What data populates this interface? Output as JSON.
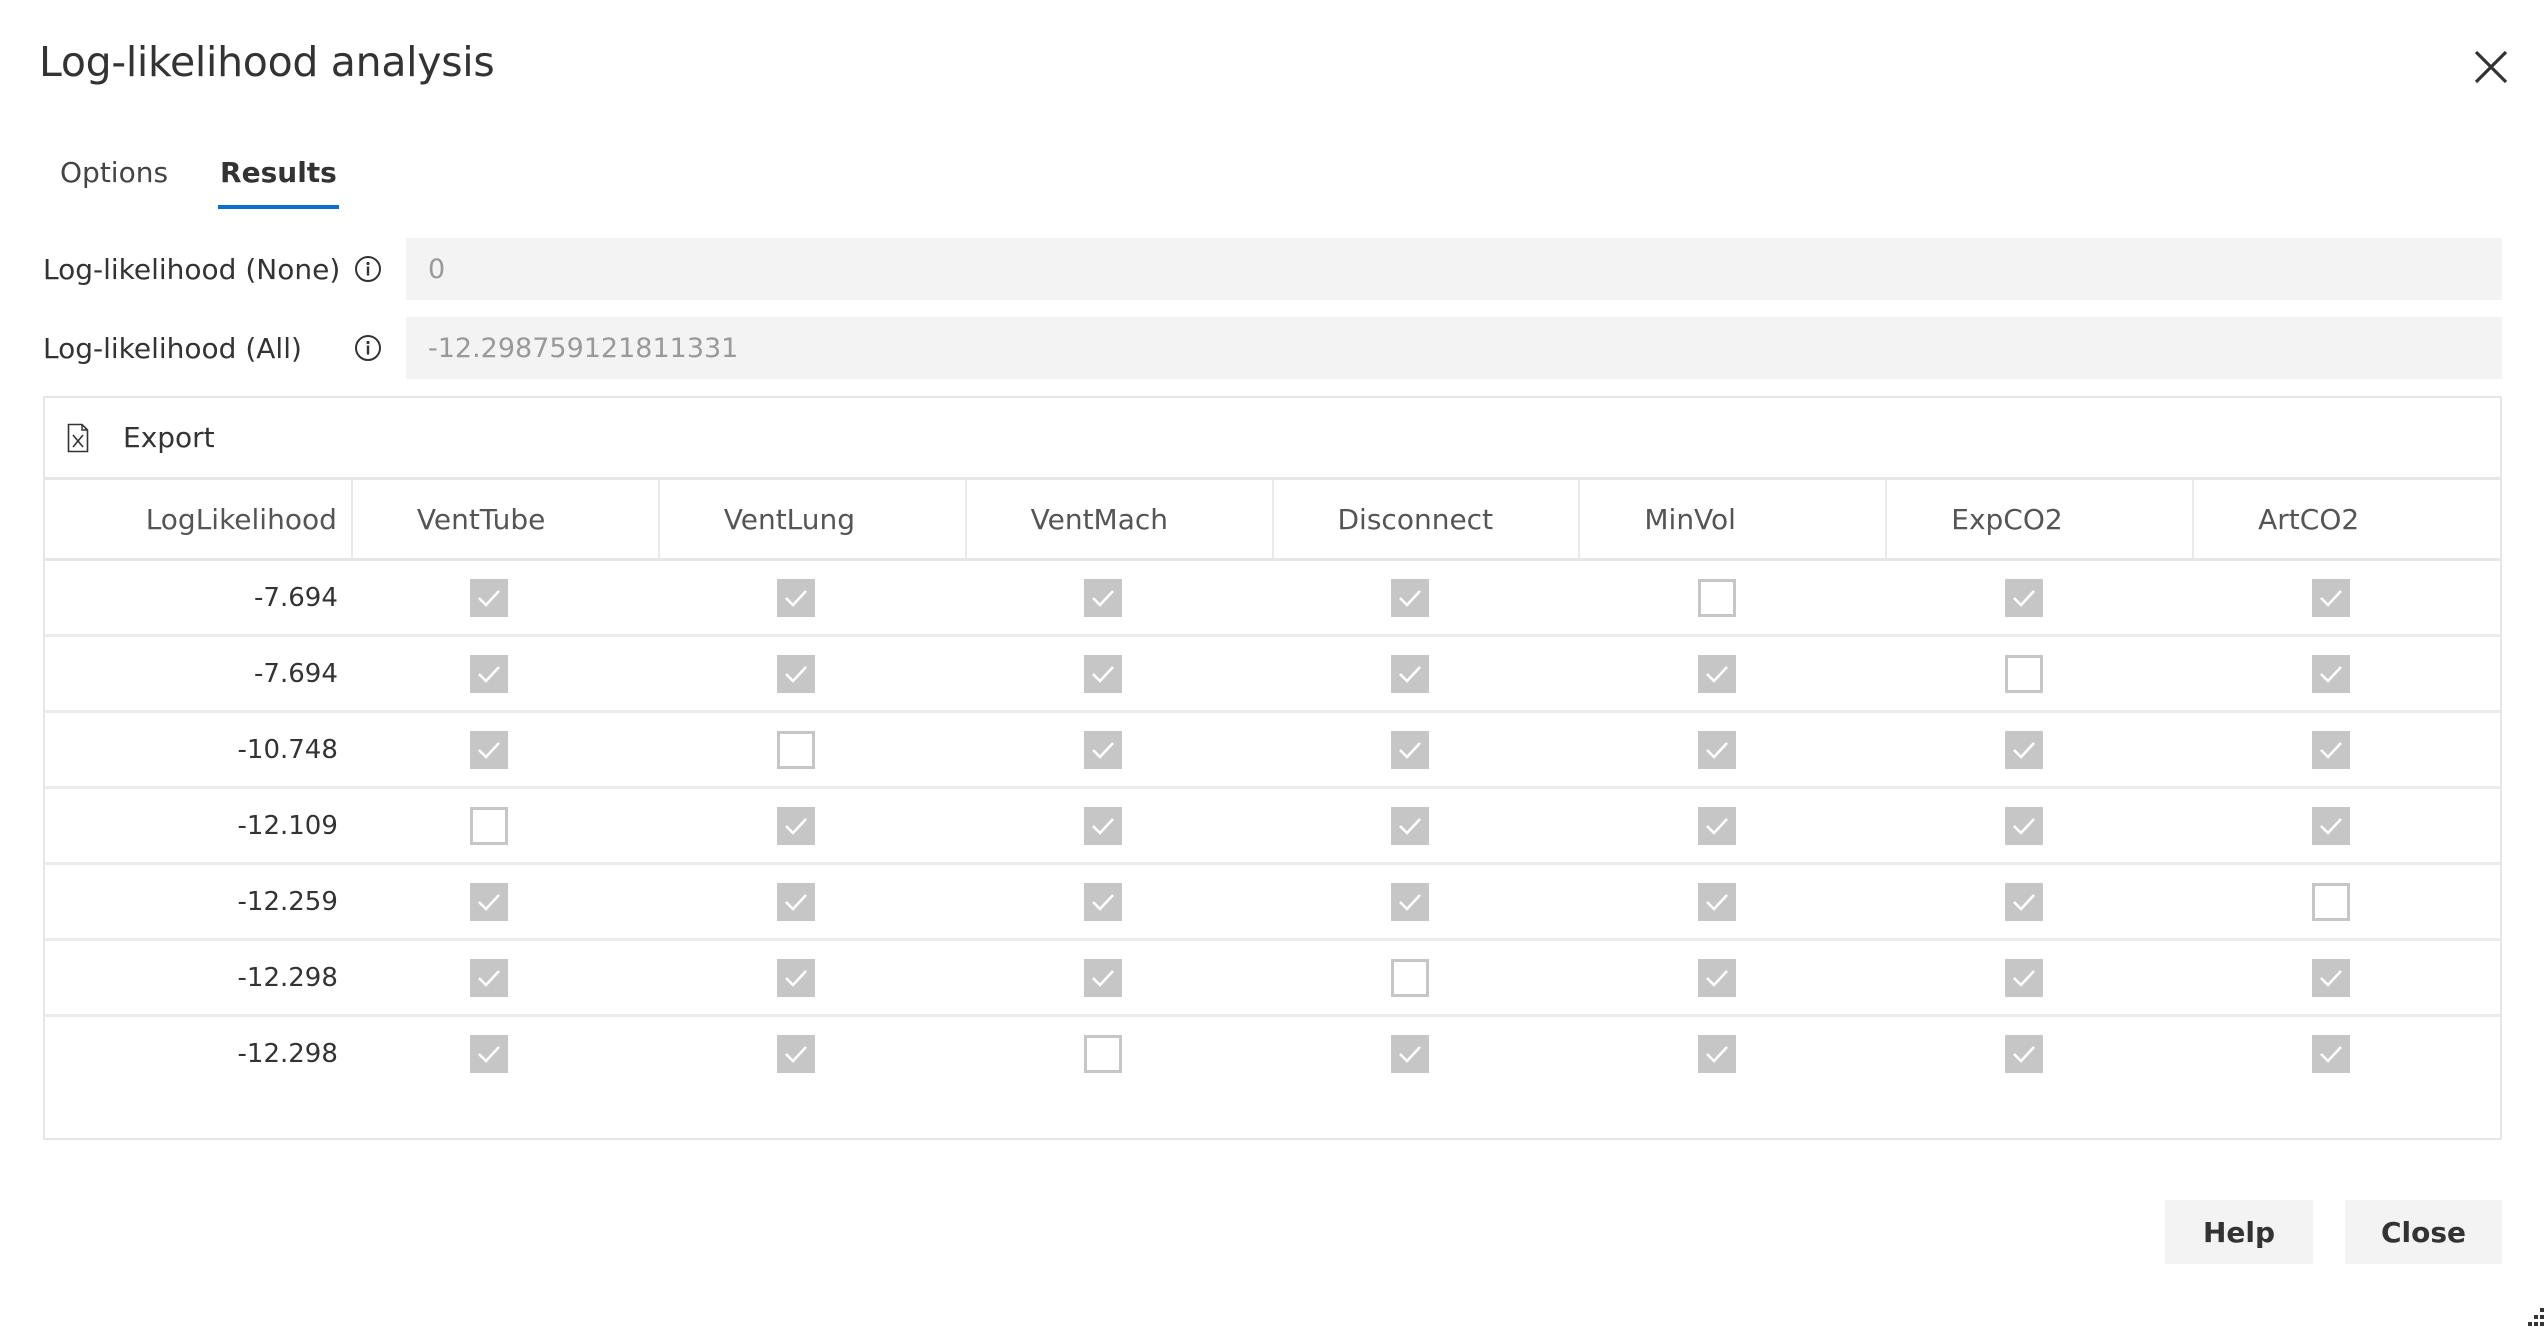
{
  "dialog": {
    "title": "Log-likelihood analysis",
    "close_icon": "close-icon"
  },
  "tabs": [
    {
      "label": "Options",
      "active": false
    },
    {
      "label": "Results",
      "active": true
    }
  ],
  "fields": [
    {
      "label": "Log-likelihood (None)",
      "icon": "info-icon",
      "value": "0"
    },
    {
      "label": "Log-likelihood (All)",
      "icon": "info-icon",
      "value": "-12.298759121811331"
    }
  ],
  "toolbar": {
    "export_label": "Export",
    "export_icon": "excel-file-icon"
  },
  "table": {
    "columns": [
      "LogLikelihood",
      "VentTube",
      "VentLung",
      "VentMach",
      "Disconnect",
      "MinVol",
      "ExpCO2",
      "ArtCO2"
    ],
    "rows": [
      {
        "loglik": "-7.694",
        "checks": [
          true,
          true,
          true,
          true,
          false,
          true,
          true
        ]
      },
      {
        "loglik": "-7.694",
        "checks": [
          true,
          true,
          true,
          true,
          true,
          false,
          true
        ]
      },
      {
        "loglik": "-10.748",
        "checks": [
          true,
          false,
          true,
          true,
          true,
          true,
          true
        ]
      },
      {
        "loglik": "-12.109",
        "checks": [
          false,
          true,
          true,
          true,
          true,
          true,
          true
        ]
      },
      {
        "loglik": "-12.259",
        "checks": [
          true,
          true,
          true,
          true,
          true,
          true,
          false
        ]
      },
      {
        "loglik": "-12.298",
        "checks": [
          true,
          true,
          true,
          false,
          true,
          true,
          true
        ]
      },
      {
        "loglik": "-12.298",
        "checks": [
          true,
          true,
          false,
          true,
          true,
          true,
          true
        ]
      }
    ]
  },
  "footer": {
    "help_label": "Help",
    "close_label": "Close"
  },
  "colors": {
    "accent": "#0b6fcf",
    "checkbox_gray": "#c6c6c6",
    "input_bg": "#f3f3f3"
  }
}
